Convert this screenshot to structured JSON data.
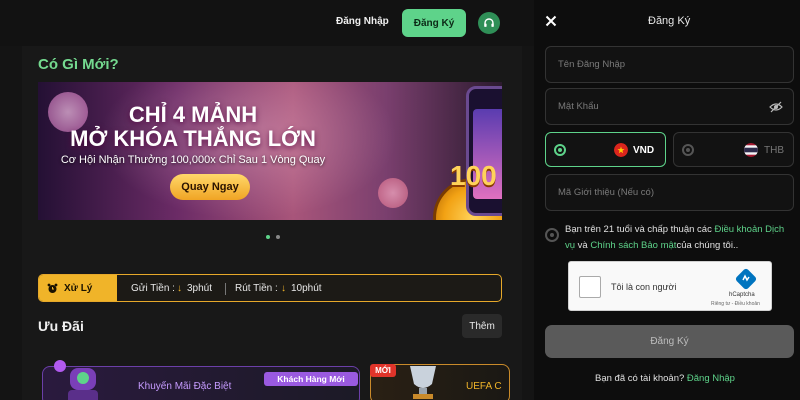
{
  "header": {
    "login_label": "Đăng Nhập",
    "register_label": "Đăng Ký",
    "support_icon": "headset-icon"
  },
  "news": {
    "title": "Có Gì Mới?",
    "banner": {
      "line1": "CHỈ 4 MẢNH",
      "line2": "MỞ KHÓA THẮNG LỚN",
      "subtitle": "Cơ Hội Nhận Thưởng 100,000x Chỉ Sau 1 Vòng Quay",
      "button": "Quay Ngay",
      "badge_number": "100"
    },
    "slides_total": 2,
    "slide_active": 1
  },
  "processing": {
    "badge": "Xử Lý",
    "deposit_label": "Gửi Tiền :",
    "deposit_value": "3phút",
    "withdraw_label": "Rút Tiền :",
    "withdraw_value": "10phút"
  },
  "offers": {
    "title": "Ưu Đãi",
    "more": "Thêm",
    "cards": [
      {
        "badge": "Khách Hàng Mới",
        "title": "Khuyến Mãi Đặc Biệt"
      },
      {
        "badge": "MỚI",
        "title": "UEFA C"
      }
    ]
  },
  "register_panel": {
    "title": "Đăng Ký",
    "username_placeholder": "Tên Đăng Nhập",
    "password_placeholder": "Mật Khẩu",
    "currencies": [
      {
        "code": "VND",
        "selected": true
      },
      {
        "code": "THB",
        "selected": false
      }
    ],
    "referral_placeholder": "Mã Giới thiệu (Nếu có)",
    "terms_prefix": "Bạn trên 21 tuổi và chấp thuận các ",
    "terms_link1": "Điều khoản Dịch vụ",
    "terms_and": " và ",
    "terms_link2": "Chính sách Bảo mật",
    "terms_suffix": "của chúng tôi..",
    "captcha_label": "Tôi là con người",
    "captcha_brand": "hCaptcha",
    "captcha_links": "Riêng tư - Điều khoản",
    "submit_label": "Đăng Ký",
    "footer_prefix": "Bạn đã có tài khoản? ",
    "footer_link": "Đăng Nhập"
  },
  "colors": {
    "accent_green": "#5ed38a",
    "accent_gold": "#f0b429",
    "purple": "#9a5ae0"
  }
}
